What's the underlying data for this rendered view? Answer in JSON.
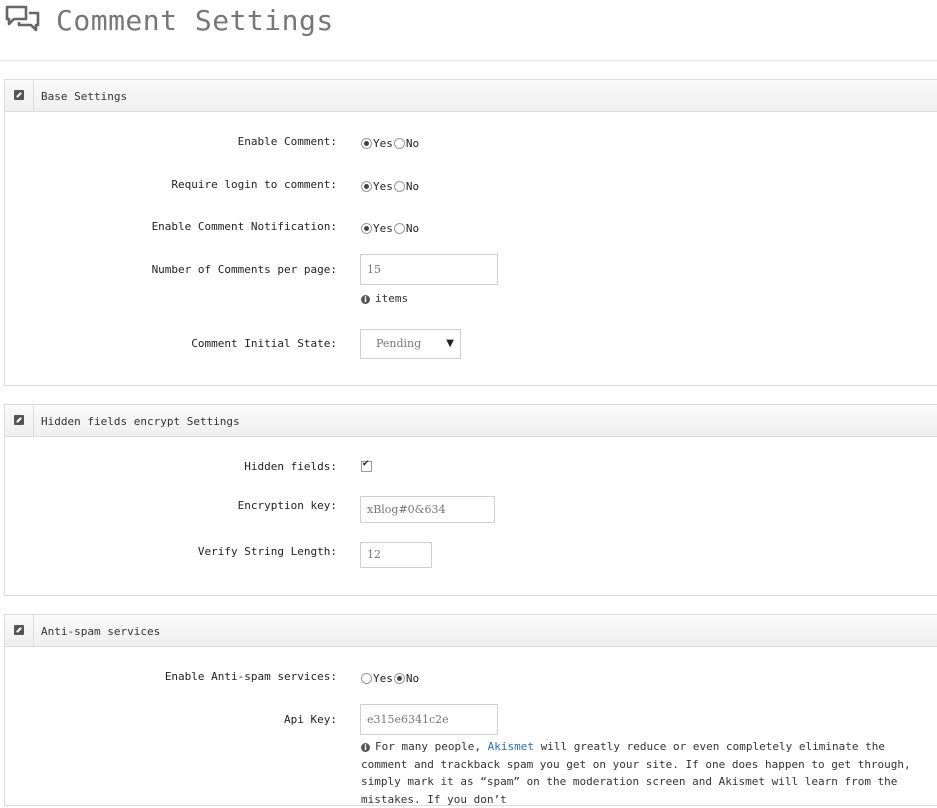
{
  "page": {
    "title": "Comment Settings",
    "icon": "comments-icon"
  },
  "base_settings": {
    "title": "Base Settings",
    "enable_comment": {
      "label": "Enable Comment:",
      "yes": "Yes",
      "no": "No",
      "value": "Yes"
    },
    "require_login": {
      "label": "Require login to comment:",
      "yes": "Yes",
      "no": "No",
      "value": "Yes"
    },
    "enable_notification": {
      "label": "Enable Comment Notification:",
      "yes": "Yes",
      "no": "No",
      "value": "Yes"
    },
    "comments_per_page": {
      "label": "Number of Comments per page:",
      "value": "15",
      "help": "items"
    },
    "initial_state": {
      "label": "Comment Initial State:",
      "value": "Pending",
      "arrow": "▼"
    }
  },
  "hidden_fields": {
    "title": "Hidden fields encrypt Settings",
    "hidden_fields": {
      "label": "Hidden fields:",
      "checked": true
    },
    "encryption_key": {
      "label": "Encryption key:",
      "value": "xBlog#0&634"
    },
    "verify_length": {
      "label": "Verify String Length:",
      "value": "12"
    }
  },
  "anti_spam": {
    "title": "Anti-spam services",
    "enable": {
      "label": "Enable Anti-spam services:",
      "yes": "Yes",
      "no": "No",
      "value": "No"
    },
    "api_key": {
      "label": "Api Key:",
      "value": "e315e6341c2e"
    },
    "help": {
      "before": "For many people, ",
      "link": "Akismet",
      "after": " will greatly reduce or even completely eliminate the comment and trackback spam you get on your site. If one does happen to get through, simply mark it as “spam” on the moderation screen and Akismet will learn from the mistakes. If you don’t"
    }
  },
  "colors": {
    "link": "#2a6fb0",
    "border": "#dcdcdc"
  }
}
